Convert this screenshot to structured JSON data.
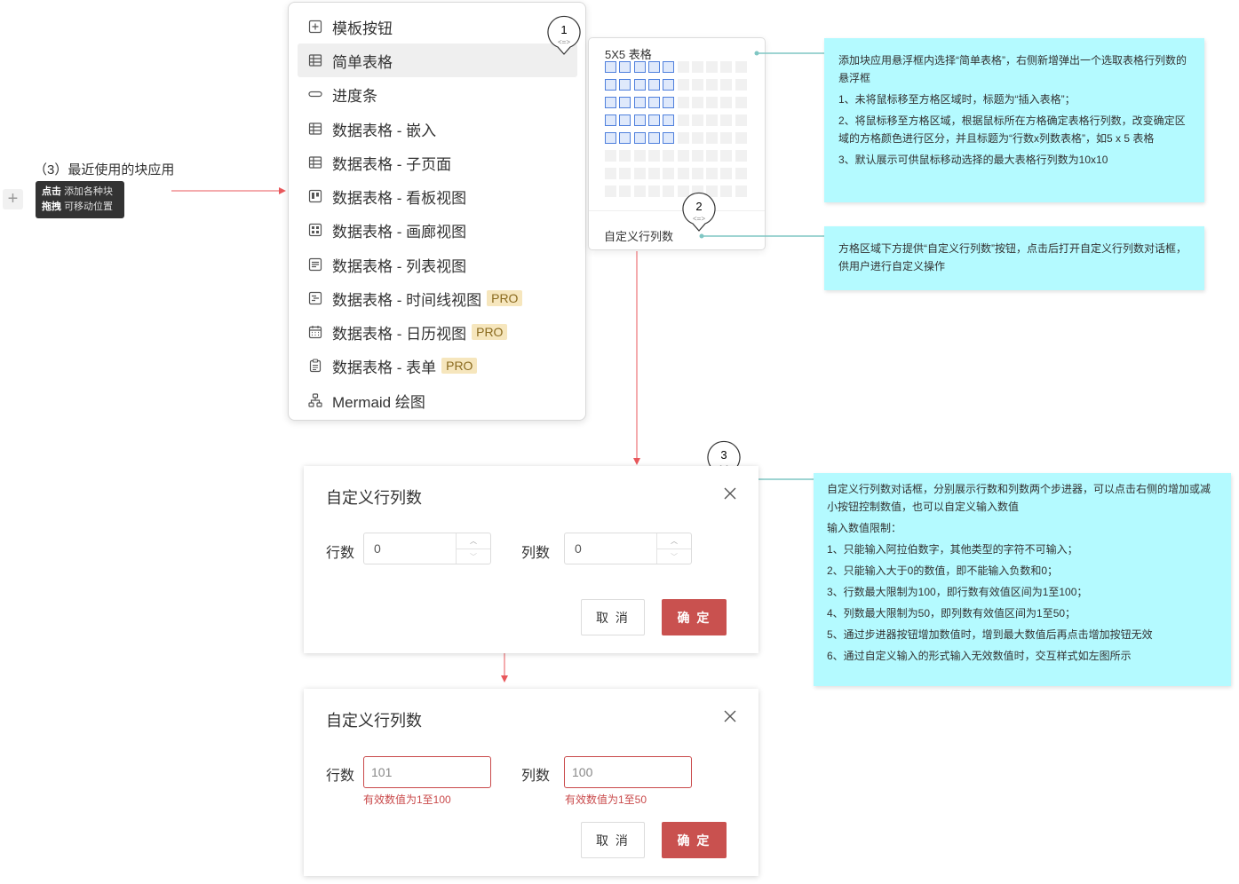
{
  "section": {
    "title": "（3）最近使用的块应用",
    "plus": "+"
  },
  "tooltip": {
    "click_key": "点击",
    "click_text": "添加各种块",
    "drag_key": "拖拽",
    "drag_text": "可移动位置"
  },
  "menu": {
    "items": [
      {
        "label": "模板按钮",
        "icon": "template-button-icon",
        "pro": ""
      },
      {
        "label": "简单表格",
        "icon": "table-icon",
        "pro": ""
      },
      {
        "label": "进度条",
        "icon": "progress-bar-icon",
        "pro": ""
      },
      {
        "label": "数据表格 - 嵌入",
        "icon": "table-icon",
        "pro": ""
      },
      {
        "label": "数据表格 - 子页面",
        "icon": "table-icon",
        "pro": ""
      },
      {
        "label": "数据表格 - 看板视图",
        "icon": "kanban-icon",
        "pro": ""
      },
      {
        "label": "数据表格 - 画廊视图",
        "icon": "gallery-icon",
        "pro": ""
      },
      {
        "label": "数据表格 - 列表视图",
        "icon": "list-view-icon",
        "pro": ""
      },
      {
        "label": "数据表格 - 时间线视图",
        "icon": "timeline-icon",
        "pro": "PRO"
      },
      {
        "label": "数据表格 - 日历视图",
        "icon": "calendar-icon",
        "pro": "PRO"
      },
      {
        "label": "数据表格 - 表单",
        "icon": "form-icon",
        "pro": "PRO"
      },
      {
        "label": "Mermaid 绘图",
        "icon": "diagram-icon",
        "pro": ""
      }
    ],
    "active_index": 1
  },
  "picker": {
    "title": "5X5 表格",
    "rows": 8,
    "cols": 10,
    "selected_rows": 5,
    "selected_cols": 5,
    "custom_label": "自定义行列数"
  },
  "markers": [
    {
      "number": "1",
      "link": "<=>"
    },
    {
      "number": "2",
      "link": "<=>"
    },
    {
      "number": "3",
      "link": "<=>"
    }
  ],
  "notes": {
    "note1": [
      "添加块应用悬浮框内选择“简单表格”，右侧新增弹出一个选取表格行列数的悬浮框",
      "1、未将鼠标移至方格区域时，标题为“插入表格”；",
      "2、将鼠标移至方格区域，根据鼠标所在方格确定表格行列数，改变确定区域的方格颜色进行区分，并且标题为“行数x列数表格”，如5 x 5 表格",
      "3、默认展示可供鼠标移动选择的最大表格行列数为10x10"
    ],
    "note2": "方格区域下方提供“自定义行列数”按钮，点击后打开自定义行列数对话框，供用户进行自定义操作",
    "note3": [
      "自定义行列数对话框，分别展示行数和列数两个步进器，可以点击右侧的增加或减小按钮控制数值，也可以自定义输入数值",
      "输入数值限制：",
      "1、只能输入阿拉伯数字，其他类型的字符不可输入；",
      "2、只能输入大于0的数值，即不能输入负数和0；",
      "3、行数最大限制为100，即行数有效值区间为1至100；",
      "4、列数最大限制为50，即列数有效值区间为1至50；",
      "5、通过步进器按钮增加数值时，增到最大数值后再点击增加按钮无效",
      "6、通过自定义输入的形式输入无效数值时，交互样式如左图所示"
    ]
  },
  "dialog1": {
    "title": "自定义行列数",
    "rows_label": "行数",
    "rows_value": "0",
    "cols_label": "列数",
    "cols_value": "0",
    "cancel": "取 消",
    "ok": "确 定"
  },
  "dialog2": {
    "title": "自定义行列数",
    "rows_label": "行数",
    "rows_value": "101",
    "rows_error": "有效数值为1至100",
    "cols_label": "列数",
    "cols_value": "100",
    "cols_error": "有效数值为1至50",
    "cancel": "取 消",
    "ok": "确 定"
  },
  "colors": {
    "connector_red": "#e8575b",
    "connector_teal": "#7fc6c3",
    "note_bg": "#b4faff",
    "grid_selected": "#4f80dd",
    "ok_button": "#c9514f",
    "error": "#c9494a",
    "pro_badge": "#f6e6bd"
  }
}
